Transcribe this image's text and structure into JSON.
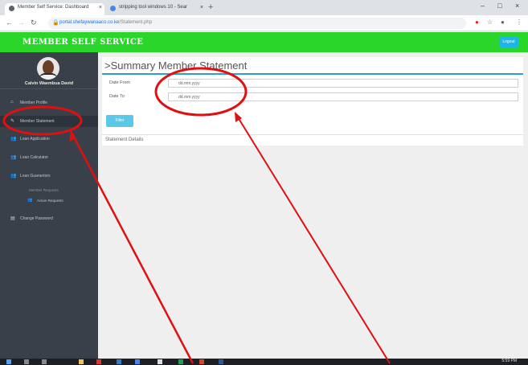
{
  "browser": {
    "tabs": [
      {
        "title": "Member Self Service: Dashboard",
        "active": true
      },
      {
        "title": "stripping tool windows 10 - Sear",
        "active": false
      }
    ],
    "url_host": "portal.shefaywanaaco.co.ke",
    "url_path": "/Statement.php"
  },
  "app": {
    "title": "MEMBER SELF SERVICE",
    "logout_label": "Logout",
    "header_color": "#2bd62b"
  },
  "user": {
    "name": "Calvin Waembua David"
  },
  "sidebar": {
    "items": [
      {
        "icon": "home-icon",
        "label": "Member Profile"
      },
      {
        "icon": "pencil-icon",
        "label": "Member Statement"
      },
      {
        "icon": "users-icon",
        "label": "Loan Application"
      },
      {
        "icon": "users-icon",
        "label": "Loan Calculator"
      },
      {
        "icon": "users-icon",
        "label": "Loan Guarantors"
      }
    ],
    "sub_heading": "Member Requests",
    "sub_items": [
      {
        "icon": "users-icon",
        "label": "Action Requests"
      }
    ],
    "last_item": {
      "icon": "document-icon",
      "label": "Change Password"
    }
  },
  "main": {
    "title": ">Summary Member Statement",
    "date_from_label": "Date From",
    "date_from_placeholder": "dd.mm.yyyy",
    "date_to_label": "Date To",
    "date_to_placeholder": "dd.mm.yyyy",
    "filter_label": "Filter",
    "section_title": "Statement Details"
  },
  "taskbar": {
    "time": "5:59 PM"
  },
  "annotations": {
    "color": "#e01010"
  }
}
